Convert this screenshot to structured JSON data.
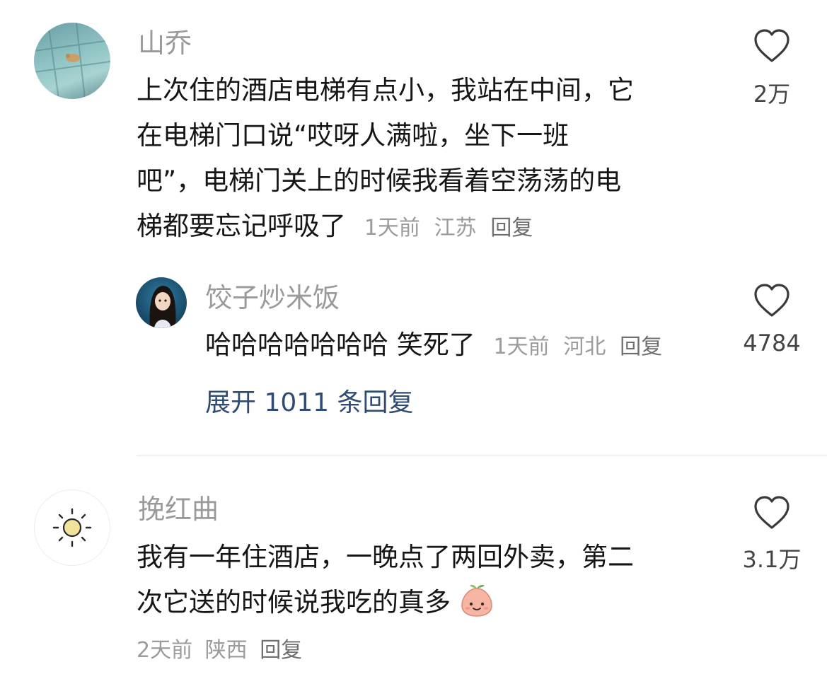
{
  "comments": [
    {
      "username": "山乔",
      "text_lines": [
        "上次住的酒店电梯有点小，我站在中间，它",
        "在电梯门口说“哎呀人满啦，坐下一班",
        "吧”，电梯门关上的时候我看着空荡荡的电",
        "梯都要忘记呼吸了"
      ],
      "time": "1天前",
      "location": "江苏",
      "reply_label": "回复",
      "likes": "2万",
      "like_icon": "heart-outline-icon",
      "replies": [
        {
          "username": "饺子炒米饭",
          "text": "哈哈哈哈哈哈哈 笑死了",
          "time": "1天前",
          "location": "河北",
          "reply_label": "回复",
          "likes": "4784",
          "like_icon": "heart-outline-icon"
        }
      ],
      "expand_label": "展开 1011 条回复"
    },
    {
      "username": "挽红曲",
      "text_lines": [
        "我有一年住酒店，一晚点了两回外卖，第二",
        "次它送的时候说我吃的真多"
      ],
      "emoji": "peach-face-emoji",
      "time": "2天前",
      "location": "陕西",
      "reply_label": "回复",
      "likes": "3.1万",
      "like_icon": "heart-outline-icon"
    }
  ],
  "colors": {
    "username": "#9a9a9a",
    "text": "#161616",
    "meta": "#9b9b9b",
    "link": "#2f4a73",
    "divider": "#e8e8e8"
  }
}
